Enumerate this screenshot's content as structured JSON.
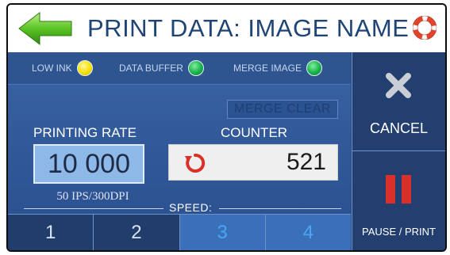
{
  "header": {
    "title": "PRINT DATA: IMAGE NAME",
    "back_icon": "arrow-left-icon",
    "help_icon": "lifebuoy-icon"
  },
  "status": {
    "low_ink": "LOW INK",
    "data_buffer": "DATA BUFFER",
    "merge_image": "MERGE IMAGE",
    "low_ink_color": "#f3e100",
    "data_buffer_color": "#17b14a",
    "merge_image_color": "#17b14a"
  },
  "merge_clear": "MERGE CLEAR",
  "printing_rate": {
    "label": "PRINTING RATE",
    "value": "10 000",
    "sub": "50 IPS/300DPI"
  },
  "counter": {
    "label": "COUNTER",
    "value": "521",
    "reset_icon": "reset-icon"
  },
  "speed": {
    "label": "SPEED:",
    "buttons": [
      "1",
      "2",
      "3",
      "4"
    ]
  },
  "side": {
    "cancel_label": "CANCEL",
    "pause_label": "PAUSE / PRINT"
  },
  "colors": {
    "accent": "#1f4476",
    "panel": "#2f5696",
    "pause": "#d9302a"
  }
}
